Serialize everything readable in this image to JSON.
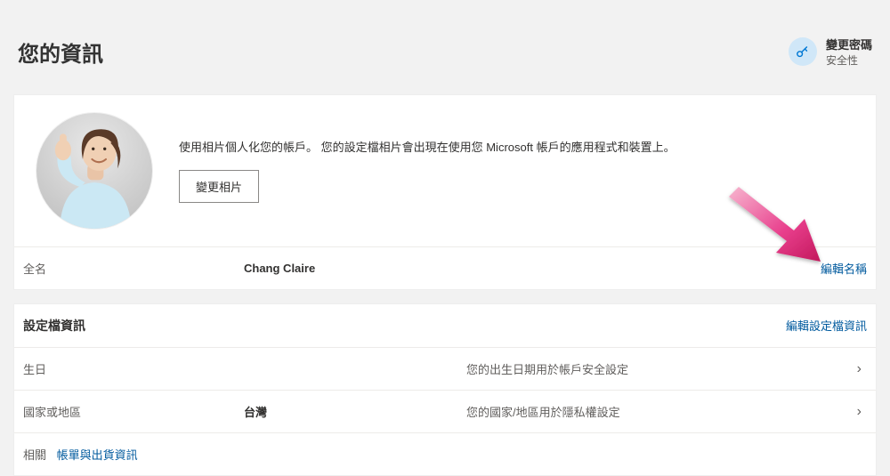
{
  "header": {
    "title": "您的資訊",
    "quick_action": {
      "title": "變更密碼",
      "subtitle": "安全性"
    }
  },
  "profile": {
    "description": "使用相片個人化您的帳戶。 您的設定檔相片會出現在使用您 Microsoft 帳戶的應用程式和裝置上。",
    "change_photo_label": "變更相片"
  },
  "full_name": {
    "label": "全名",
    "value": "Chang Claire",
    "edit_link": "編輯名稱"
  },
  "profile_info": {
    "header": "設定檔資訊",
    "edit_link": "編輯設定檔資訊",
    "rows": [
      {
        "label": "生日",
        "value": "",
        "note": "您的出生日期用於帳戶安全設定"
      },
      {
        "label": "國家或地區",
        "value": "台灣",
        "note": "您的國家/地區用於隱私權設定"
      }
    ],
    "related_label": "相關",
    "related_link": "帳單與出貨資訊"
  }
}
